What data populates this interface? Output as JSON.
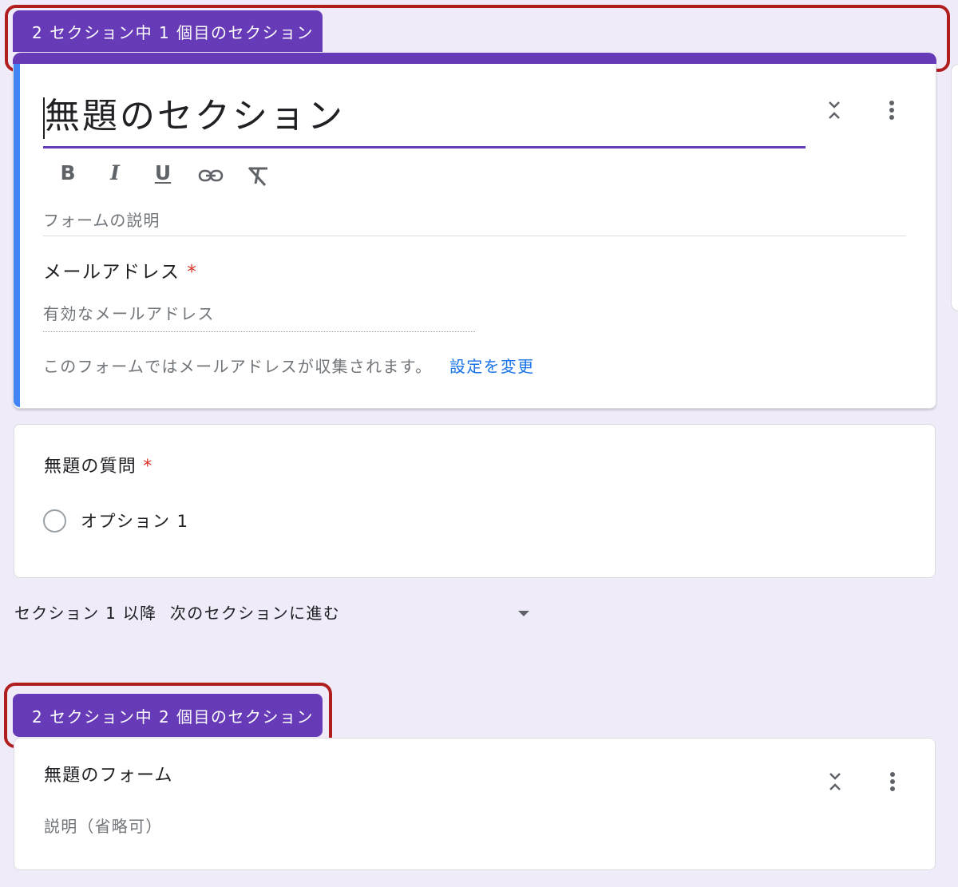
{
  "section1": {
    "tab_label": "2 セクション中 1 個目のセクション",
    "title": "無題のセクション",
    "description_placeholder": "フォームの説明",
    "email_question": "メールアドレス",
    "email_placeholder": "有効なメールアドレス",
    "email_notice": "このフォームではメールアドレスが収集されます。",
    "change_settings": "設定を変更"
  },
  "question": {
    "title": "無題の質問",
    "required_mark": "*",
    "option1": "オプション 1"
  },
  "after_section": {
    "label": "セクション 1 以降",
    "value": "次のセクションに進む"
  },
  "section2": {
    "tab_label": "2 セクション中 2 個目のセクション",
    "title": "無題のフォーム",
    "description_placeholder": "説明（省略可）"
  },
  "toolbar": {
    "bold": "B",
    "italic": "I",
    "underline": "U"
  },
  "colors": {
    "accent": "#673ab7",
    "focus_bar": "#4285f4",
    "highlight": "#b01e1e",
    "link": "#1a73e8",
    "required": "#d93025"
  },
  "icons": [
    "collapse-icon",
    "more-vert-icon",
    "link-icon",
    "clear-format-icon",
    "dropdown-arrow-icon",
    "radio-icon"
  ]
}
